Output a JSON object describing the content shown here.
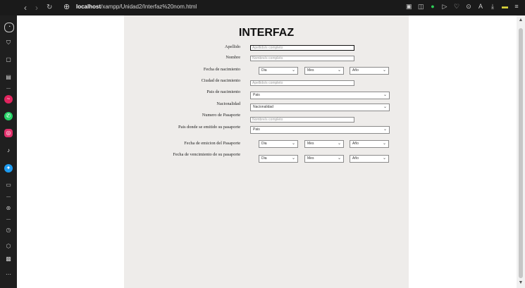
{
  "browser": {
    "url_host": "localhost",
    "url_path": "/xampp/Unidad2/Interfaz%20nom.html"
  },
  "form": {
    "title": "INTERFAZ",
    "rows": [
      {
        "label": "Apellido",
        "placeholder": "Apellido/s completo"
      },
      {
        "label": "Nombre",
        "placeholder": "Nombre/s completo"
      },
      {
        "label": "Fecha de nacimiento",
        "day": "Dia",
        "month": "Mes",
        "year": "Año"
      },
      {
        "label": "Ciudad de nacimiento",
        "placeholder": "Apellido/s completo"
      },
      {
        "label": "Pais de nacimiento",
        "value": "Pais"
      },
      {
        "label": "Nacionalidad",
        "value": "Nacionalidad"
      },
      {
        "label": "Numero de Pasaporte",
        "placeholder": "Nombre/s completo"
      },
      {
        "label": "Pais donde se emitido su pasaporte",
        "value": "Pais"
      },
      {
        "label": "Fecha de emicion del Pasaporte",
        "day": "Dia",
        "month": "Mes",
        "year": "Año"
      },
      {
        "label": "Fecha de vencimiento de su pasaporte",
        "day": "Dia",
        "month": "Mes",
        "year": "Año"
      }
    ]
  },
  "icons": {
    "chevron": "chevron-down-icon"
  }
}
